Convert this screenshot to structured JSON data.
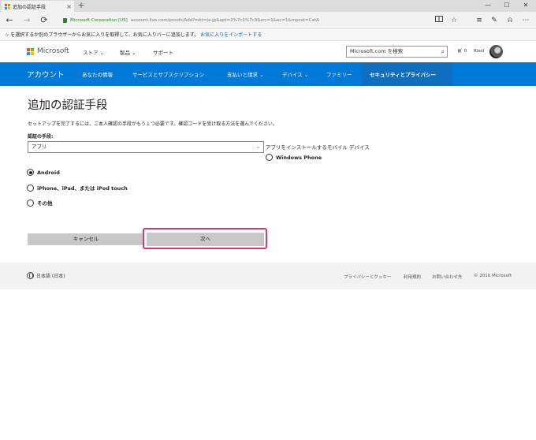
{
  "browser": {
    "tab_title": "追加の認証手段",
    "tab_close": "×",
    "new_tab": "+",
    "win_min": "—",
    "win_max": "☐",
    "win_close": "✕",
    "url_corp": "Microsoft Corporation [US]",
    "url_path": "account.live.com/proofs/Add?mkt=ja-jp&apt=2%7c1%7c3&src=1&ec=1&mpcxt=CatA",
    "back": "←",
    "forward": "→",
    "refresh": "⟳",
    "favbar_text": "☆ を選択するか別のブラウザーからお気に入りを取得して、お気に入りバーに追加します。",
    "favbar_link": "お気に入りをインポートする"
  },
  "ms_header": {
    "brand": "Microsoft",
    "nav": [
      "ストア ⌄",
      "製品 ⌄",
      "サポート"
    ],
    "search_placeholder": "Microsoft.com を検索",
    "cart_count": "0",
    "user_name": "Risol"
  },
  "account_nav": {
    "account": "アカウント",
    "items": [
      "あなたの情報",
      "サービスとサブスクリプション",
      "支払いと請求 ⌄",
      "デバイス ⌄",
      "ファミリー"
    ],
    "active": "セキュリティとプライバシー"
  },
  "main": {
    "title": "追加の認証手段",
    "description": "セットアップを完了するには、ご本人確認の手段がもう１つ必要です。確認コードを受け取る方法を選んでください。",
    "method_label": "認証の手段:",
    "method_value": "アプリ",
    "app_note": "アプリをインストールするモバイル デバイス",
    "options": [
      {
        "label": "Windows Phone",
        "selected": false
      },
      {
        "label": "Android",
        "selected": true
      },
      {
        "label": "iPhone、iPad、または iPod touch",
        "selected": false
      },
      {
        "label": "その他",
        "selected": false
      }
    ],
    "cancel_label": "キャンセル",
    "next_label": "次へ"
  },
  "footer": {
    "language": "日本語 (日本)",
    "links": [
      "プライバシーとクッキー",
      "利用規約",
      "お問い合わせ先",
      "© 2016 Microsoft"
    ]
  },
  "colors": {
    "accent_blue": "#0078d7",
    "highlight": "#e2336b"
  }
}
